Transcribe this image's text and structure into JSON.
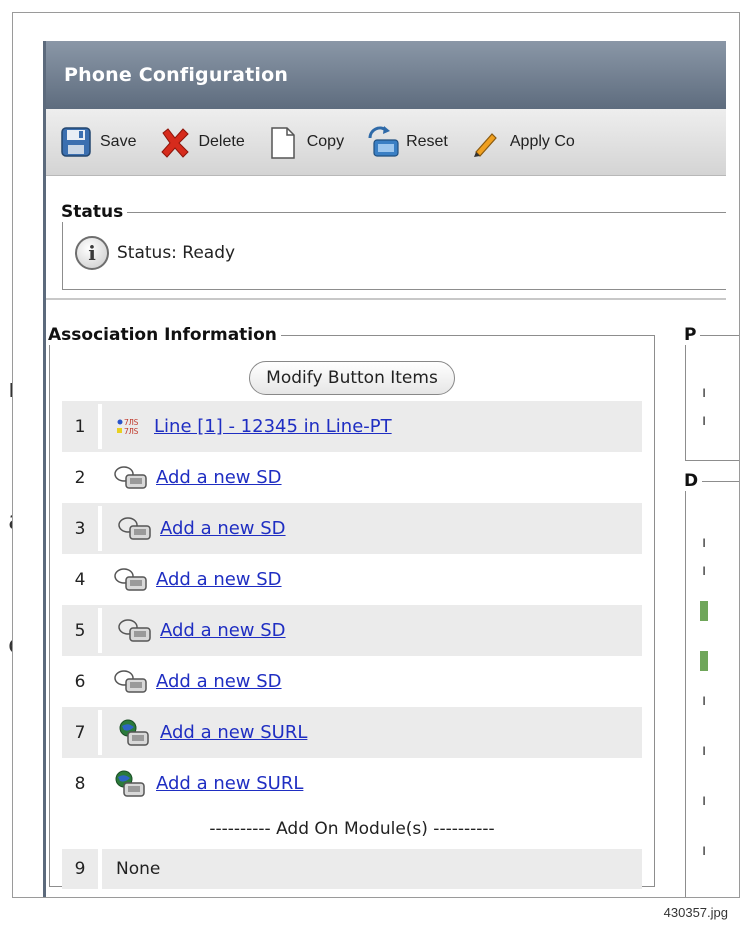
{
  "window": {
    "title": "Phone Configuration"
  },
  "toolbar": {
    "items": [
      {
        "label": "Save",
        "icon": "floppy-disk-icon"
      },
      {
        "label": "Delete",
        "icon": "red-x-icon"
      },
      {
        "label": "Copy",
        "icon": "copy-document-icon"
      },
      {
        "label": "Reset",
        "icon": "reset-phone-icon"
      },
      {
        "label": "Apply Co",
        "icon": "pencil-icon"
      }
    ]
  },
  "status": {
    "legend": "Status",
    "text": "Status: Ready"
  },
  "association": {
    "legend": "Association Information",
    "modify_button": "Modify Button Items",
    "rows": [
      {
        "num": "1",
        "label": "Line [1] - 12345 in Line-PT",
        "type": "line",
        "shaded": true
      },
      {
        "num": "2",
        "label": "Add a new SD",
        "type": "sd",
        "shaded": false
      },
      {
        "num": "3",
        "label": "Add a new SD",
        "type": "sd",
        "shaded": true
      },
      {
        "num": "4",
        "label": "Add a new SD",
        "type": "sd",
        "shaded": false
      },
      {
        "num": "5",
        "label": "Add a new SD",
        "type": "sd",
        "shaded": true
      },
      {
        "num": "6",
        "label": "Add a new SD",
        "type": "sd",
        "shaded": false
      },
      {
        "num": "7",
        "label": "Add a new SURL",
        "type": "surl",
        "shaded": true
      },
      {
        "num": "8",
        "label": "Add a new SURL",
        "type": "surl",
        "shaded": false
      }
    ],
    "addon_label": "---------- Add On Module(s) ----------",
    "row9": {
      "num": "9",
      "label": "None"
    }
  },
  "side": {
    "legend1": "P",
    "legend2": "D"
  },
  "caption": "430357.jpg",
  "colors": {
    "titlebar": "#6f7c8d",
    "link": "#1f2ec2",
    "shaded_row": "#ebebeb"
  }
}
